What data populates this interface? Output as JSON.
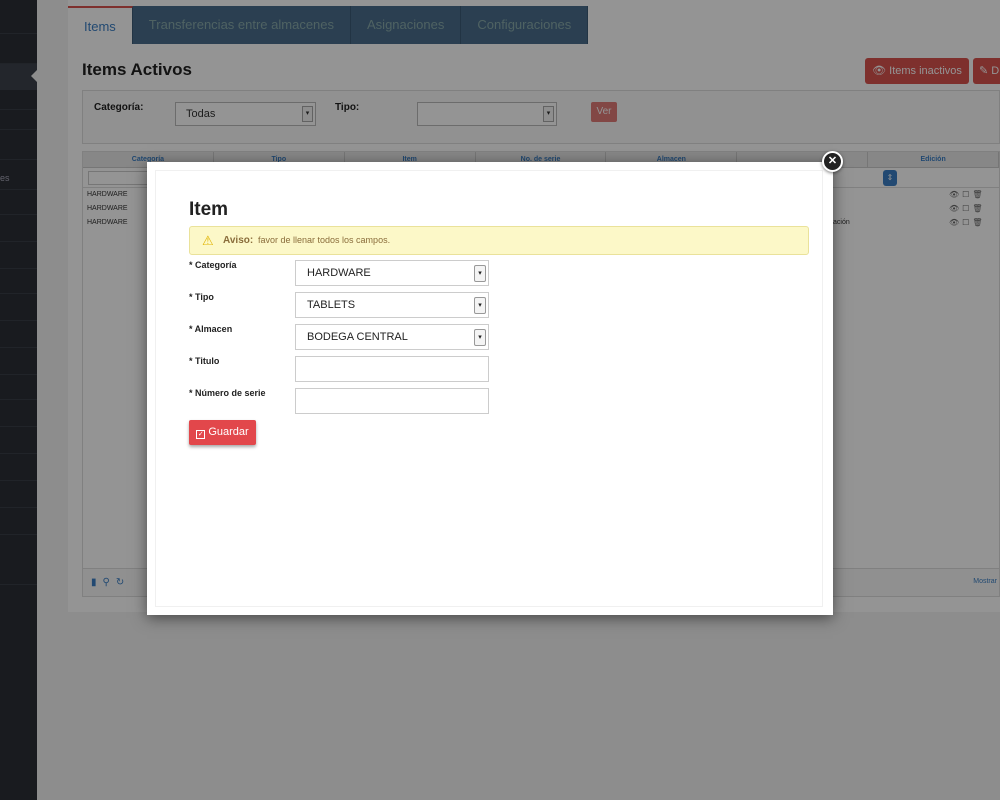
{
  "sidebar": {
    "partial_text": "es"
  },
  "tabs": [
    {
      "label": "Items"
    },
    {
      "label": "Transferencias entre almacenes"
    },
    {
      "label": "Asignaciones"
    },
    {
      "label": "Configuraciones"
    }
  ],
  "page": {
    "title": "Items Activos",
    "inactive_button": "Items inactivos",
    "d_button": "D"
  },
  "filters": {
    "categoria_label": "Categoría:",
    "categoria_value": "Todas",
    "tipo_label": "Tipo:",
    "tipo_value": "",
    "ver_button": "Ver"
  },
  "grid": {
    "columns": [
      "Categoría",
      "Tipo",
      "Item",
      "No. de serie",
      "Almacen",
      "",
      "Edición"
    ],
    "rows": [
      {
        "categoria": "HARDWARE",
        "almacen": ""
      },
      {
        "categoria": "HARDWARE",
        "almacen": ""
      },
      {
        "categoria": "HARDWARE",
        "almacen": "ación"
      }
    ],
    "footer_right": "Mostrar"
  },
  "modal": {
    "title": "Item",
    "alert_title": "Aviso:",
    "alert_message": "favor de llenar todos los campos.",
    "fields": {
      "categoria_label": "* Categoría",
      "categoria_value": "HARDWARE",
      "tipo_label": "* Tipo",
      "tipo_value": "TABLETS",
      "almacen_label": "* Almacen",
      "almacen_value": "BODEGA CENTRAL",
      "titulo_label": "* Titulo",
      "titulo_value": "",
      "serie_label": "* Número de serie",
      "serie_value": ""
    },
    "save_button": "Guardar"
  },
  "colors": {
    "accent_red": "#e2474b",
    "tab_blue": "#4a6d8c",
    "link_blue": "#3b7fc4",
    "alert_bg": "#fcf8c8"
  }
}
